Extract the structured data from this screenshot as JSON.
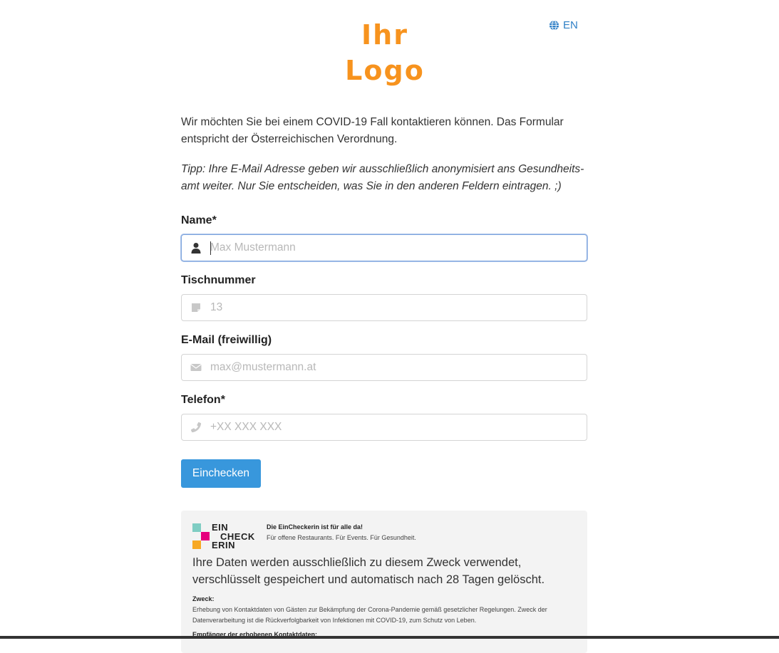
{
  "header": {
    "logo_line1": "Ihr",
    "logo_line2": "Logo",
    "lang_label": "EN",
    "lang_icon": "globe-icon"
  },
  "intro": {
    "text": "Wir möchten Sie bei einem COVID-19 Fall kontaktieren können. Das Formular entspricht der Österreichischen Verordnung.",
    "tip": "Tipp: Ihre E-Mail Adresse geben wir ausschließlich anonymisiert ans Gesundheits-amt weiter. Nur Sie entscheiden, was Sie in den anderen Feldern eintragen. ;)"
  },
  "form": {
    "fields": [
      {
        "label": "Name*",
        "placeholder": "Max Mustermann",
        "value": "",
        "icon": "user-icon",
        "focused": true
      },
      {
        "label": "Tischnummer",
        "placeholder": "13",
        "value": "",
        "icon": "sticky-note-icon"
      },
      {
        "label": "E-Mail (freiwillig)",
        "placeholder": "max@mustermann.at",
        "value": "",
        "icon": "envelope-icon"
      },
      {
        "label": "Telefon*",
        "placeholder": "+XX XXX XXX",
        "value": "",
        "icon": "phone-icon"
      }
    ],
    "submit_label": "Einchecken"
  },
  "info": {
    "brand_line1": "EIN",
    "brand_line2": "CHECK",
    "brand_line3": "ERIN",
    "brand_heading": "Die EinCheckerin ist für alle da!",
    "brand_sub": "Für offene Restaurants. Für Events. Für Gesundheit.",
    "data_text": "Ihre Daten werden ausschließlich zu diesem Zweck verwendet, verschlüsselt gespeichert und automatisch nach 28 Tagen gelöscht.",
    "purpose_heading": "Zweck:",
    "purpose_text": "Erhebung von Kontaktdaten von Gästen zur Bekämpfung der Corona-Pandemie gemäß gesetzlicher Regelungen. Zweck der Datenverarbeitung ist die Rückverfolgbarkeit von Infektionen mit COVID-19, zum Schutz von Leben.",
    "recipients_heading": "Empfänger der erhobenen Kontaktdaten:",
    "brand_colors": {
      "teal": "#7fcdc3",
      "magenta": "#e6007e",
      "orange": "#f7a823"
    }
  },
  "colors": {
    "accent": "#3897dc",
    "logo": "#f7931e",
    "link": "#2e7fc6"
  }
}
